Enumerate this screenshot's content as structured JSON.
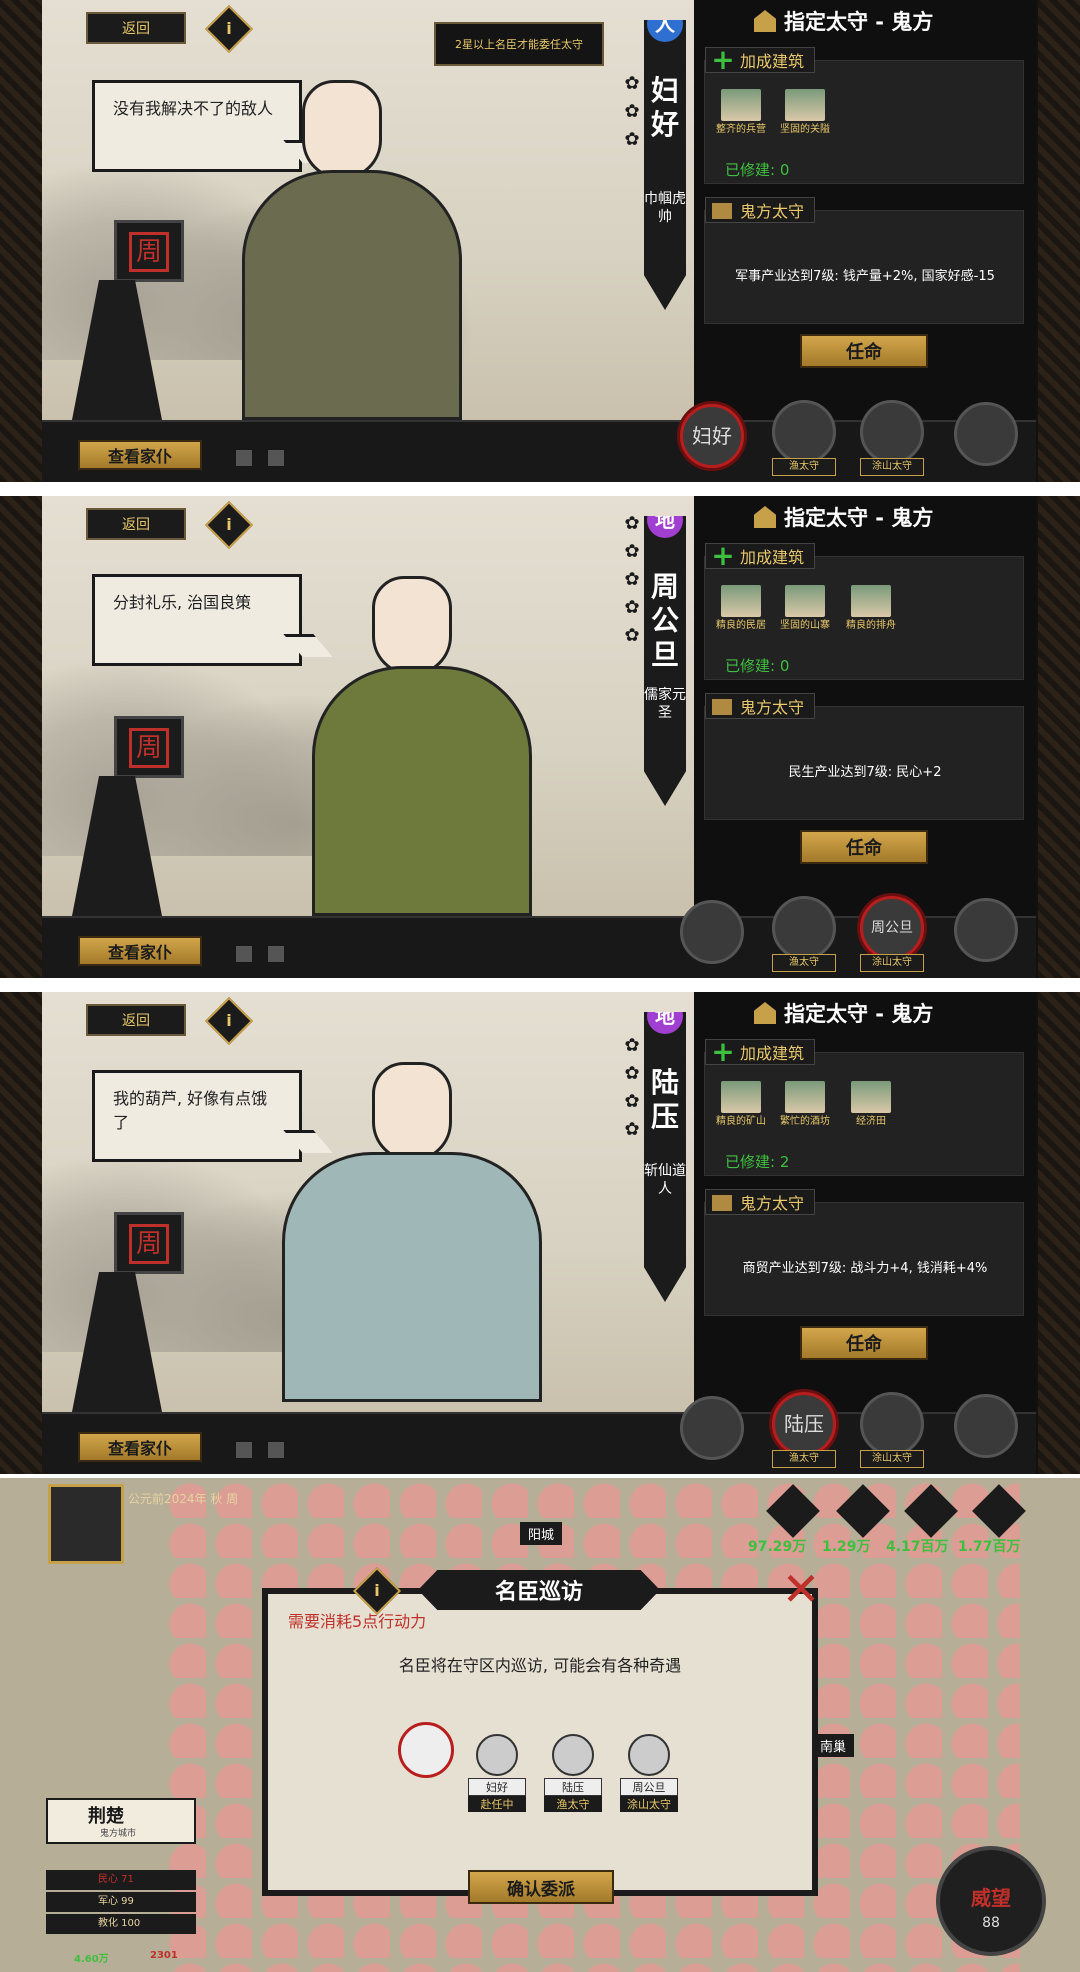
{
  "common": {
    "back_label": "返回",
    "info_label": "i",
    "view_family_label": "查看家仆",
    "panel_title": "指定太守 - 鬼方",
    "bonus_building_label": "加成建筑",
    "governor_section_label": "鬼方太守",
    "appoint_label": "任命",
    "tower_flag": "周",
    "star_glyph": "✿"
  },
  "panels": [
    {
      "speech": "没有我解决不了的敌人",
      "notice": "2星以上名臣才能委任太守",
      "type_badge": "人",
      "name": "妇好",
      "title": "巾帼虎帅",
      "buildings": [
        "整齐的兵营",
        "坚固的关隘"
      ],
      "built": "已修建: 0",
      "effect": "军事产业达到7级: 钱产量+2%, 国家好感-15",
      "avatar_tags": [
        "",
        "渔太守",
        "涂山太守",
        ""
      ]
    },
    {
      "speech": "分封礼乐, 治国良策",
      "type_badge": "地",
      "name": "周公旦",
      "title": "儒家元圣",
      "buildings": [
        "精良的民居",
        "坚固的山寨",
        "精良的排舟"
      ],
      "built": "已修建: 0",
      "effect": "民生产业达到7级: 民心+2",
      "avatar_tags": [
        "",
        "渔太守",
        "涂山太守",
        ""
      ]
    },
    {
      "speech": "我的葫芦, 好像有点饿了",
      "type_badge": "地",
      "name": "陆压",
      "title": "斩仙道人",
      "buildings": [
        "精良的矿山",
        "繁忙的酒坊",
        "经济田"
      ],
      "built": "已修建: 2",
      "effect": "商贸产业达到7级: 战斗力+4, 钱消耗+4%",
      "avatar_tags": [
        "",
        "渔太守",
        "涂山太守",
        ""
      ]
    }
  ],
  "map": {
    "date": "公元前2024年 秋  周",
    "resources": [
      "97.29万",
      "1.29万",
      "4.17百万",
      "1.77百万"
    ],
    "town_yangcheng": "阳城",
    "town_right": "南巢",
    "dialog_title": "名臣巡访",
    "cost": "需要消耗5点行动力",
    "desc": "名臣将在守区内巡访, 可能会有各种奇遇",
    "candidates": [
      {
        "name": "妇好",
        "status": "赴任中"
      },
      {
        "name": "陆压",
        "status": "渔太守"
      },
      {
        "name": "周公旦",
        "status": "涂山太守"
      }
    ],
    "confirm": "确认委派",
    "city_name": "荆楚",
    "city_sub": "鬼方城市",
    "stats": [
      "民心 71",
      "军心 99",
      "教化 100"
    ],
    "fame_label": "威望",
    "fame_value": "88",
    "bottom_left": "4.60万",
    "bottom_mid": "2301"
  },
  "colors": {
    "accent_gold": "#c7a04a",
    "alert_red": "#c0302a",
    "green": "#3fbf3f",
    "badge_blue": "#2f6fd0",
    "badge_purple": "#a13fd0"
  }
}
